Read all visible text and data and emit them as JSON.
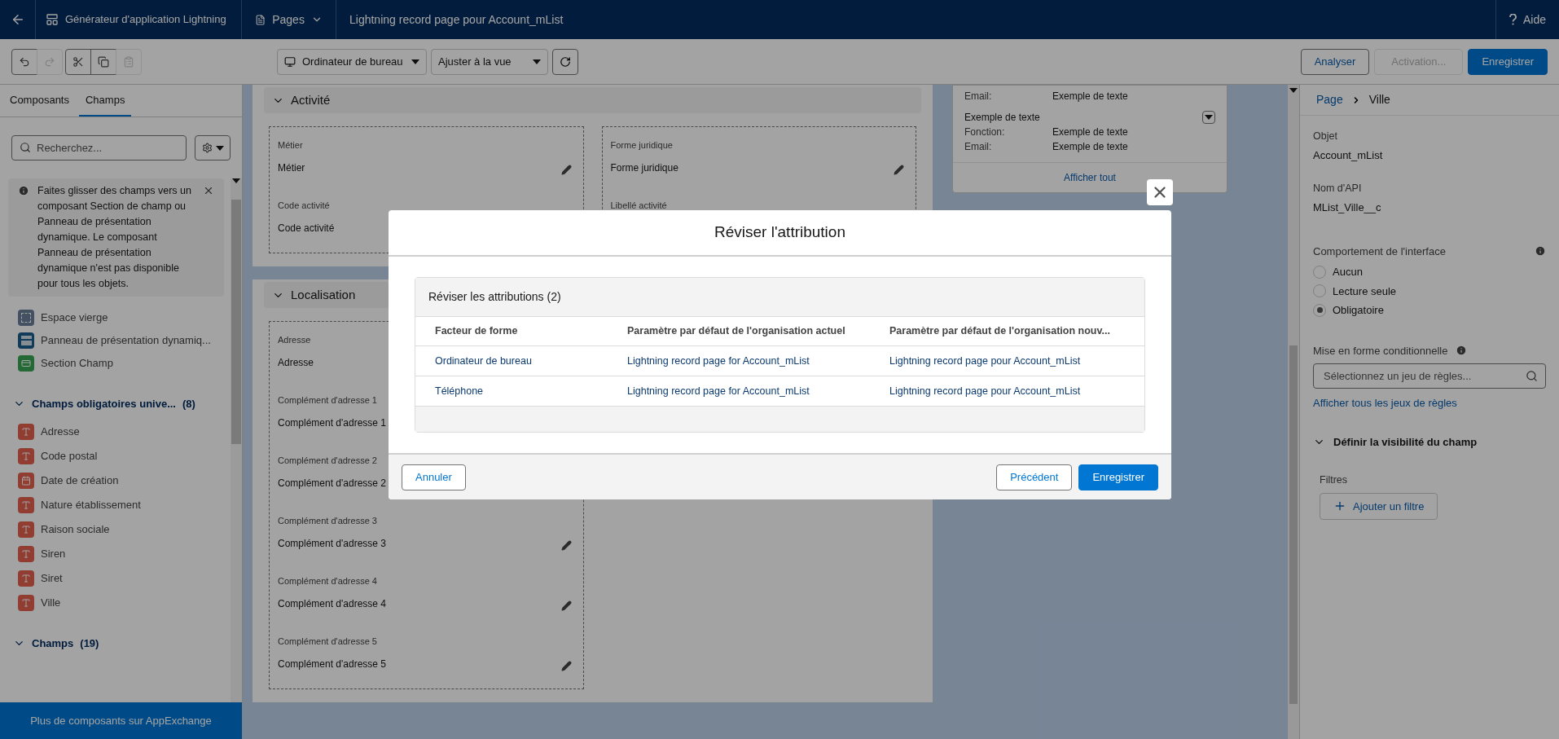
{
  "top_nav": {
    "app_name": "Générateur d'application Lightning",
    "pages_menu": "Pages",
    "page_title": "Lightning record page pour Account_mList",
    "help": "Aide"
  },
  "toolbar": {
    "tools": [
      {
        "kind": "undo",
        "disabled": false
      },
      {
        "kind": "redo",
        "disabled": true
      },
      {
        "kind": "cut",
        "disabled": false
      },
      {
        "kind": "copy",
        "disabled": false
      },
      {
        "kind": "paste",
        "disabled": true
      }
    ],
    "device": "Ordinateur de bureau",
    "zoom": "Ajuster à la vue",
    "buttons": [
      {
        "label": "Analyser",
        "kind": "outline",
        "disabled": false
      },
      {
        "label": "Activation...",
        "kind": "outline",
        "disabled": true
      },
      {
        "label": "Enregistrer",
        "kind": "brand",
        "disabled": false
      }
    ]
  },
  "left_panel": {
    "tabs": [
      {
        "label": "Composants",
        "selected": false
      },
      {
        "label": "Champs",
        "selected": true
      }
    ],
    "search": {
      "placeholder": "Recherchez..."
    },
    "info": "Faites glisser des champs vers un composant Section de champ ou Panneau de présentation dynamique. Le composant Panneau de présentation dynamique n'est pas disponible pour tous les objets.",
    "components": [
      {
        "label": "Espace vierge",
        "kind": "blank"
      },
      {
        "label": "Panneau de présentation dynamiq...",
        "kind": "panel"
      },
      {
        "label": "Section Champ",
        "kind": "section"
      }
    ],
    "groups": [
      {
        "title": "Champs obligatoires unive...",
        "count": "(8)",
        "expanded": true,
        "fields": [
          {
            "label": "Adresse",
            "kind": "text"
          },
          {
            "label": "Code postal",
            "kind": "text"
          },
          {
            "label": "Date de création",
            "kind": "date"
          },
          {
            "label": "Nature établissement",
            "kind": "text"
          },
          {
            "label": "Raison sociale",
            "kind": "text"
          },
          {
            "label": "Siren",
            "kind": "text"
          },
          {
            "label": "Siret",
            "kind": "text"
          },
          {
            "label": "Ville",
            "kind": "text"
          }
        ]
      },
      {
        "title": "Champs",
        "count": "(19)",
        "expanded": true
      }
    ],
    "appexchange": "Plus de composants sur AppExchange"
  },
  "canvas": {
    "sections": [
      {
        "title": "Activité",
        "expanded": true,
        "columns": [
          [
            {
              "label": "Métier",
              "value": "Métier"
            },
            {
              "label": "Code activité",
              "value": "Code activité"
            }
          ],
          [
            {
              "label": "Forme juridique",
              "value": "Forme juridique"
            },
            {
              "label": "Libellé activité"
            }
          ]
        ]
      },
      {
        "title": "Localisation",
        "expanded": true,
        "columns": [
          [
            {
              "label": "Adresse",
              "value": "Adresse"
            },
            {
              "label": "Complément d'adresse 1",
              "value": "Complément d'adresse 1"
            },
            {
              "label": "Complément d'adresse 2",
              "value": "Complément d'adresse 2"
            },
            {
              "label": "Complément d'adresse 3",
              "value": "Complément d'adresse 3"
            },
            {
              "label": "Complément d'adresse 4",
              "value": "Complément d'adresse 4"
            },
            {
              "label": "Complément d'adresse 5",
              "value": "Complément d'adresse 5"
            }
          ]
        ]
      }
    ],
    "related_card": {
      "fields": [
        {
          "label": "Email:",
          "value": "Exemple de texte"
        }
      ],
      "record": {
        "title": "Exemple de texte",
        "fields": [
          {
            "label": "Fonction:",
            "value": "Exemple de texte"
          },
          {
            "label": "Email:",
            "value": "Exemple de texte"
          }
        ]
      },
      "view_all": "Afficher tout"
    }
  },
  "properties": {
    "breadcrumb": [
      "Page",
      "Ville"
    ],
    "object": {
      "label": "Objet",
      "value": "Account_mList"
    },
    "api_name": {
      "label": "Nom d'API",
      "value": "MList_Ville__c"
    },
    "behavior": {
      "label": "Comportement de l'interface",
      "options": [
        {
          "label": "Aucun",
          "selected": false
        },
        {
          "label": "Lecture seule",
          "selected": false
        },
        {
          "label": "Obligatoire",
          "selected": true
        }
      ]
    },
    "conditional": {
      "label": "Mise en forme conditionnelle",
      "placeholder": "Sélectionnez un jeu de règles...",
      "link": "Afficher tous les jeux de règles"
    },
    "visibility": {
      "title": "Définir la visibilité du champ",
      "expanded": true,
      "filters_label": "Filtres",
      "add_filter": "Ajouter un filtre"
    }
  },
  "modal": {
    "title": "Réviser l'attribution",
    "card_title": "Réviser les attributions (2)",
    "columns": [
      "Facteur de forme",
      "Paramètre par défaut de l'organisation actuel",
      "Paramètre par défaut de l'organisation nouv..."
    ],
    "rows": [
      [
        "Ordinateur de bureau",
        "Lightning record page for Account_mList",
        "Lightning record page pour Account_mList"
      ],
      [
        "Téléphone",
        "Lightning record page for Account_mList",
        "Lightning record page pour Account_mList"
      ]
    ],
    "buttons": [
      {
        "label": "Annuler",
        "kind": "neutral"
      },
      {
        "label": "Précédent",
        "kind": "neutral"
      },
      {
        "label": "Enregistrer",
        "kind": "brand"
      }
    ]
  }
}
